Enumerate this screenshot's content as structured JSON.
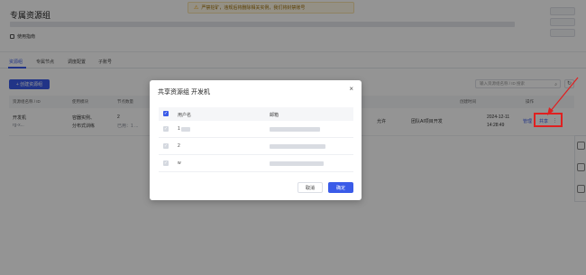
{
  "page": {
    "title": "专属资源组",
    "doc_link": "使用指南",
    "notice": "严禁挖矿，违规后将删除相关实例，我们将封禁账号"
  },
  "tabs": [
    {
      "label": "资源组",
      "active": true
    },
    {
      "label": "专属节点",
      "active": false
    },
    {
      "label": "调度配置",
      "active": false
    },
    {
      "label": "子账号",
      "active": false
    }
  ],
  "toolbar": {
    "create_label": "+ 创建资源组",
    "search_placeholder": "输入资源组名称 / ID 搜索",
    "refresh_icon": "refresh-icon"
  },
  "table": {
    "headers": [
      "资源组名称 / ID",
      "使用模块",
      "节点数量",
      "资源",
      "创建时间",
      "操作"
    ],
    "row": {
      "name": "开发机",
      "id": "rg-x...",
      "module_line1": "容器实例、",
      "module_line2": "分布式训练",
      "nodes_line1": "2",
      "nodes_line2": "已用：1 ...",
      "mode": "允许",
      "desc": "团队AI项目开发",
      "created_date": "2024-12-11",
      "created_time": "14:28:49",
      "action_edit": "管理",
      "action_share": "共享",
      "action_more": "⋮"
    }
  },
  "dialog": {
    "title": "共享资源组 开发机",
    "close_icon": "×",
    "col_user": "用户名",
    "col_email": "邮箱",
    "rows": [
      {
        "user": "1",
        "email_masked": true
      },
      {
        "user": "2",
        "email_masked": true
      },
      {
        "user": "w",
        "email_masked": true
      }
    ],
    "cancel_label": "取消",
    "ok_label": "确定"
  },
  "colors": {
    "accent": "#3a5be8",
    "highlight": "#e02020"
  }
}
